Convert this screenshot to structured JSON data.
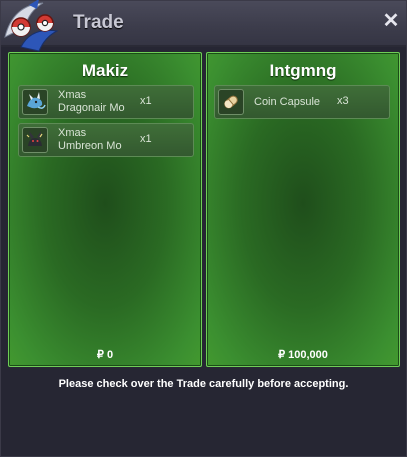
{
  "window": {
    "title": "Trade"
  },
  "left_panel": {
    "player": "Makiz",
    "items": [
      {
        "name": "Xmas\nDragonair Mo",
        "qty": "x1",
        "icon": "dragonair-mount-icon"
      },
      {
        "name": "Xmas\nUmbreon Mo",
        "qty": "x1",
        "icon": "umbreon-mount-icon"
      }
    ],
    "money": "₽ 0"
  },
  "right_panel": {
    "player": "Intgmng",
    "items": [
      {
        "name": "Coin Capsule",
        "qty": "x3",
        "icon": "coin-capsule-icon"
      }
    ],
    "money": "₽ 100,000"
  },
  "footer_text": "Please check over the Trade carefully before accepting.",
  "colors": {
    "panel_border": "#6fce57",
    "panel_green": "#2a6a23",
    "background": "#262633"
  }
}
